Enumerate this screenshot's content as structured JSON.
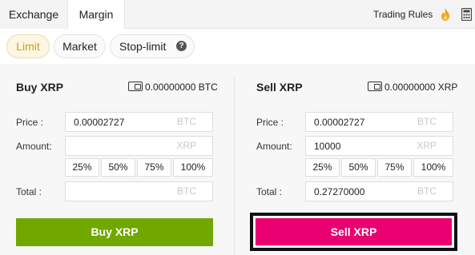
{
  "tabs": {
    "exchange": "Exchange",
    "margin": "Margin",
    "trading_rules": "Trading Rules"
  },
  "order_types": {
    "limit": "Limit",
    "market": "Market",
    "stop_limit": "Stop-limit",
    "help": "?"
  },
  "buy": {
    "title": "Buy XRP",
    "balance": "0.00000000 BTC",
    "price_label": "Price :",
    "price_value": "0.00002727",
    "price_unit": "BTC",
    "amount_label": "Amount:",
    "amount_value": "",
    "amount_unit": "XRP",
    "total_label": "Total :",
    "total_value": "",
    "total_unit": "BTC",
    "percents": [
      "25%",
      "50%",
      "75%",
      "100%"
    ],
    "button": "Buy XRP"
  },
  "sell": {
    "title": "Sell XRP",
    "balance": "0.00000000 XRP",
    "price_label": "Price :",
    "price_value": "0.00002727",
    "price_unit": "BTC",
    "amount_label": "Amount:",
    "amount_value": "10000",
    "amount_unit": "XRP",
    "total_label": "Total :",
    "total_value": "0.27270000",
    "total_unit": "BTC",
    "percents": [
      "25%",
      "50%",
      "75%",
      "100%"
    ],
    "button": "Sell XRP"
  },
  "colors": {
    "buy": "#70a800",
    "sell": "#ea0070",
    "accent": "#d29b0e"
  },
  "icons": [
    "fire-icon",
    "calculator-icon",
    "wallet-icon",
    "help-icon"
  ]
}
